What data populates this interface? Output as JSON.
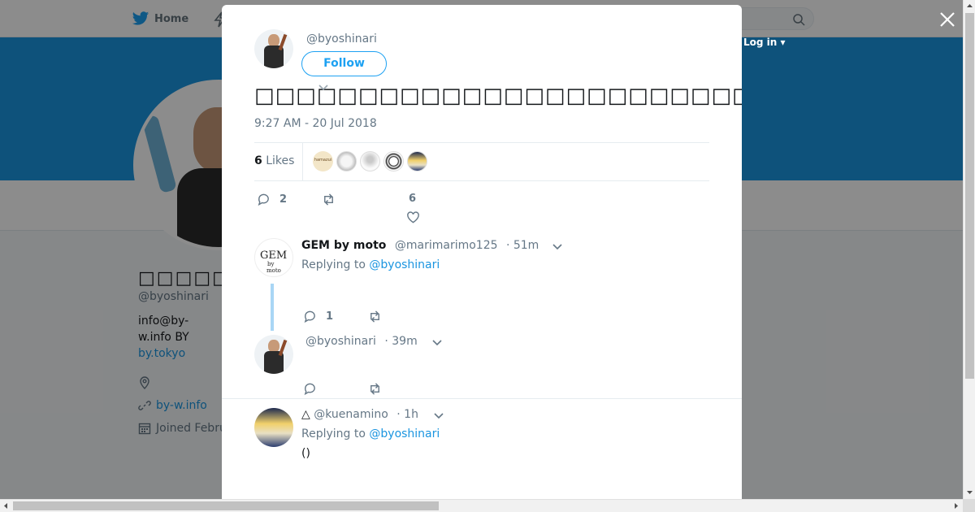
{
  "nav": {
    "home_label": "Home",
    "login_label": "Log in ▾"
  },
  "profile": {
    "name": "□□□□□",
    "handle": "@byoshinari",
    "bio_line1": " info@by-",
    "bio_line2": "w.info BY",
    "bio_link": "by.tokyo",
    "website": "by-w.info",
    "joined": "Joined Febru"
  },
  "tweet": {
    "handle": "@byoshinari",
    "follow_label": "Follow",
    "text": "□□□□□□□□□□□□□□□□□□□□□□□□□□□□□□□□□□□□□□□□□□□□□□□□□",
    "timestamp": "9:27 AM - 20 Jul 2018",
    "likes_count": "6",
    "likes_label": "Likes",
    "reply_count": "2",
    "like_count": "6"
  },
  "likers": [
    {
      "label": "hamazui",
      "color": "#f3e6c8"
    },
    {
      "label": "",
      "color": "#d9d9d9"
    },
    {
      "label": "",
      "color": "#eeeeee"
    },
    {
      "label": "",
      "color": "#f0f0f0"
    },
    {
      "label": "",
      "color": "#2c3e70"
    }
  ],
  "replies": [
    {
      "name": "GEM by moto",
      "handle": "@marimarimo125",
      "time": "· 51m",
      "replying_label": "Replying to",
      "replying_to": "@byoshinari",
      "reply_count": "1",
      "avatar_text": "GEM by moto"
    },
    {
      "name": "",
      "handle": "@byoshinari",
      "time": "· 39m",
      "reply_count": ""
    },
    {
      "name": "△",
      "handle": "@kuenamino",
      "time": "· 1h",
      "replying_label": "Replying to",
      "replying_to": "@byoshinari",
      "body": "()"
    }
  ],
  "colors": {
    "accent": "#1da1f2",
    "banner": "#1b95e0",
    "link": "#1b95e0"
  }
}
